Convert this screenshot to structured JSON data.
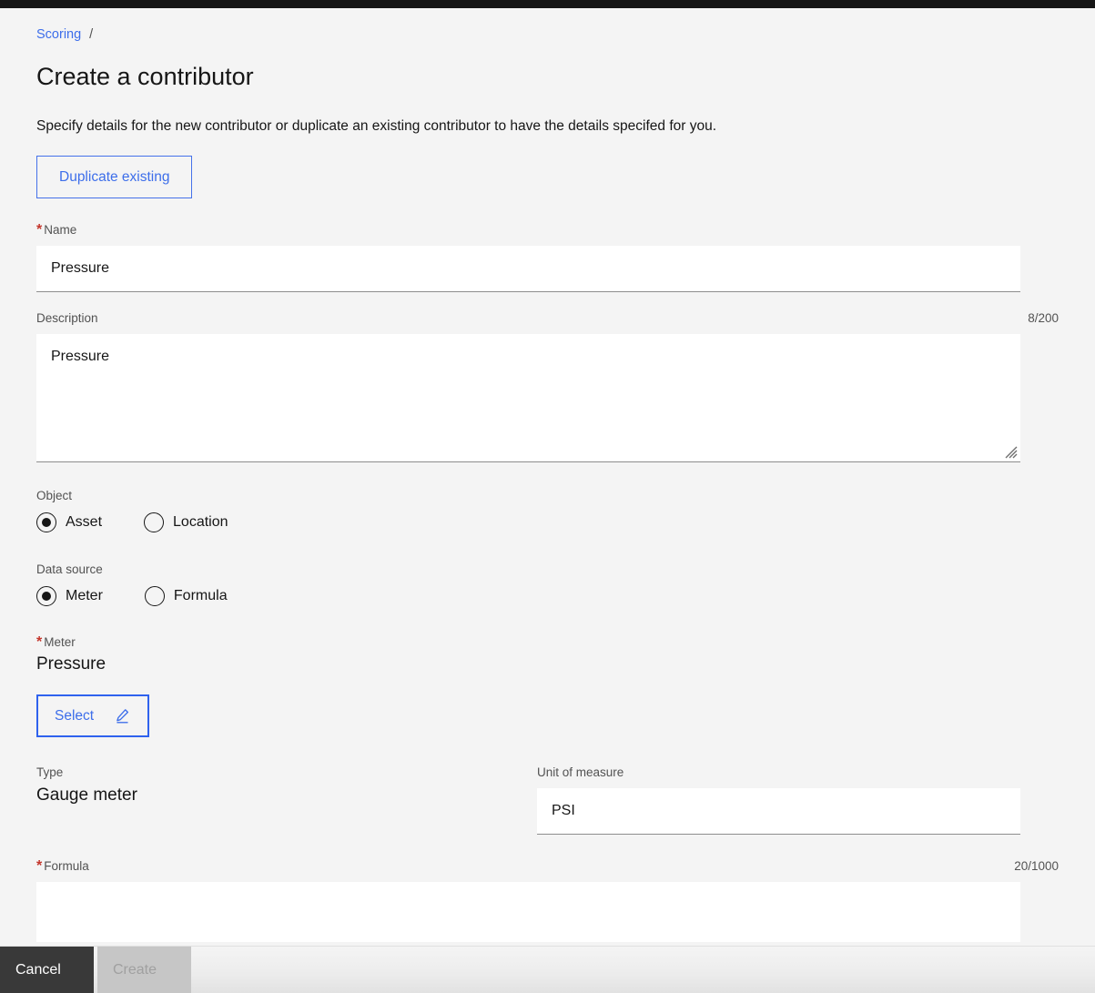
{
  "breadcrumb": {
    "link_label": "Scoring",
    "separator": "/"
  },
  "header": {
    "title": "Create a contributor",
    "intro": "Specify details for the new contributor or duplicate an existing contributor to have the details specifed for you."
  },
  "actions": {
    "duplicate_label": "Duplicate existing"
  },
  "form": {
    "name": {
      "label": "Name",
      "required_marker": "*",
      "value": "Pressure",
      "placeholder": ""
    },
    "description": {
      "label": "Description",
      "value": "Pressure",
      "placeholder": "",
      "counter": "8/200"
    },
    "object": {
      "label": "Object",
      "selected": "Asset",
      "options": [
        {
          "label": "Asset",
          "checked": true
        },
        {
          "label": "Location",
          "checked": false
        }
      ]
    },
    "data_source": {
      "label": "Data source",
      "selected": "Meter",
      "options": [
        {
          "label": "Meter",
          "checked": true
        },
        {
          "label": "Formula",
          "checked": false
        }
      ]
    },
    "meter": {
      "label": "Meter",
      "required_marker": "*",
      "value": "Pressure",
      "select_button_label": "Select",
      "select_button_icon": "edit-pencil-icon"
    },
    "type": {
      "label": "Type",
      "value": "Gauge meter"
    },
    "unit_of_measure": {
      "label": "Unit of measure",
      "value": "PSI",
      "placeholder": ""
    },
    "formula": {
      "label": "Formula",
      "required_marker": "*",
      "counter": "20/1000",
      "value": ""
    }
  },
  "footer": {
    "cancel_label": "Cancel",
    "create_label": "Create"
  },
  "colors": {
    "accent_blue": "#3d6eea",
    "border_blue": "#2f62ee",
    "required_red": "#c4352b",
    "page_bg": "#f4f4f4",
    "field_bg": "#ffffff",
    "field_underline": "#8d8d8d",
    "label_gray": "#525252",
    "text_primary": "#161616",
    "cancel_bg": "#393939",
    "create_disabled_bg": "#c6c6c6"
  }
}
